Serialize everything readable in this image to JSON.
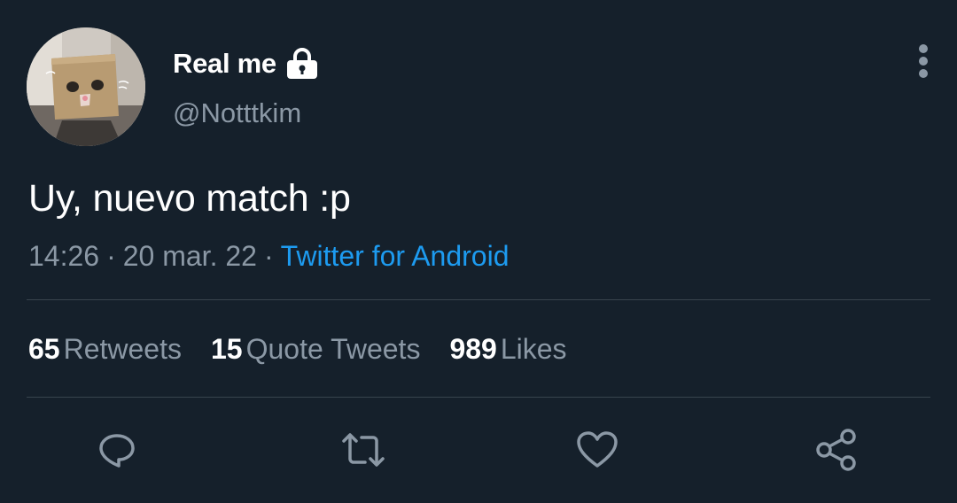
{
  "tweet": {
    "display_name": "Real me",
    "handle": "@Notttkim",
    "text": "Uy, nuevo match :p",
    "time": "14:26",
    "date": "20 mar. 22",
    "separator": "·",
    "source": "Twitter for Android"
  },
  "stats": {
    "retweets_count": "65",
    "retweets_label": "Retweets",
    "quotes_count": "15",
    "quotes_label": "Quote Tweets",
    "likes_count": "989",
    "likes_label": "Likes"
  },
  "icons": {
    "lock": "lock-icon",
    "more": "more-vertical-icon",
    "reply": "reply-icon",
    "retweet": "retweet-icon",
    "like": "heart-icon",
    "share": "share-icon"
  },
  "colors": {
    "background": "#15202b",
    "text_primary": "#ffffff",
    "text_secondary": "#8b98a5",
    "accent": "#1d9bf0",
    "divider": "#38444d"
  }
}
